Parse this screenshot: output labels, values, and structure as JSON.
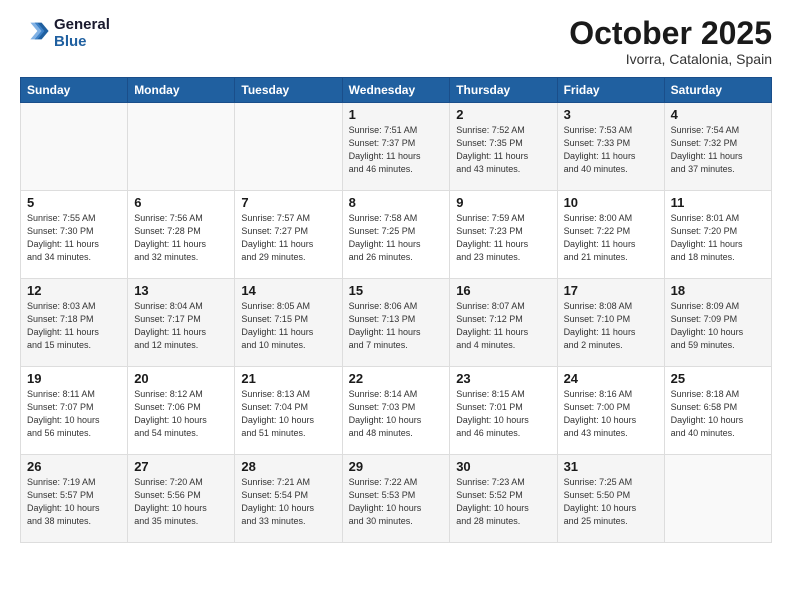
{
  "logo": {
    "line1": "General",
    "line2": "Blue"
  },
  "title": "October 2025",
  "subtitle": "Ivorra, Catalonia, Spain",
  "days_header": [
    "Sunday",
    "Monday",
    "Tuesday",
    "Wednesday",
    "Thursday",
    "Friday",
    "Saturday"
  ],
  "weeks": [
    [
      {
        "num": "",
        "info": ""
      },
      {
        "num": "",
        "info": ""
      },
      {
        "num": "",
        "info": ""
      },
      {
        "num": "1",
        "info": "Sunrise: 7:51 AM\nSunset: 7:37 PM\nDaylight: 11 hours\nand 46 minutes."
      },
      {
        "num": "2",
        "info": "Sunrise: 7:52 AM\nSunset: 7:35 PM\nDaylight: 11 hours\nand 43 minutes."
      },
      {
        "num": "3",
        "info": "Sunrise: 7:53 AM\nSunset: 7:33 PM\nDaylight: 11 hours\nand 40 minutes."
      },
      {
        "num": "4",
        "info": "Sunrise: 7:54 AM\nSunset: 7:32 PM\nDaylight: 11 hours\nand 37 minutes."
      }
    ],
    [
      {
        "num": "5",
        "info": "Sunrise: 7:55 AM\nSunset: 7:30 PM\nDaylight: 11 hours\nand 34 minutes."
      },
      {
        "num": "6",
        "info": "Sunrise: 7:56 AM\nSunset: 7:28 PM\nDaylight: 11 hours\nand 32 minutes."
      },
      {
        "num": "7",
        "info": "Sunrise: 7:57 AM\nSunset: 7:27 PM\nDaylight: 11 hours\nand 29 minutes."
      },
      {
        "num": "8",
        "info": "Sunrise: 7:58 AM\nSunset: 7:25 PM\nDaylight: 11 hours\nand 26 minutes."
      },
      {
        "num": "9",
        "info": "Sunrise: 7:59 AM\nSunset: 7:23 PM\nDaylight: 11 hours\nand 23 minutes."
      },
      {
        "num": "10",
        "info": "Sunrise: 8:00 AM\nSunset: 7:22 PM\nDaylight: 11 hours\nand 21 minutes."
      },
      {
        "num": "11",
        "info": "Sunrise: 8:01 AM\nSunset: 7:20 PM\nDaylight: 11 hours\nand 18 minutes."
      }
    ],
    [
      {
        "num": "12",
        "info": "Sunrise: 8:03 AM\nSunset: 7:18 PM\nDaylight: 11 hours\nand 15 minutes."
      },
      {
        "num": "13",
        "info": "Sunrise: 8:04 AM\nSunset: 7:17 PM\nDaylight: 11 hours\nand 12 minutes."
      },
      {
        "num": "14",
        "info": "Sunrise: 8:05 AM\nSunset: 7:15 PM\nDaylight: 11 hours\nand 10 minutes."
      },
      {
        "num": "15",
        "info": "Sunrise: 8:06 AM\nSunset: 7:13 PM\nDaylight: 11 hours\nand 7 minutes."
      },
      {
        "num": "16",
        "info": "Sunrise: 8:07 AM\nSunset: 7:12 PM\nDaylight: 11 hours\nand 4 minutes."
      },
      {
        "num": "17",
        "info": "Sunrise: 8:08 AM\nSunset: 7:10 PM\nDaylight: 11 hours\nand 2 minutes."
      },
      {
        "num": "18",
        "info": "Sunrise: 8:09 AM\nSunset: 7:09 PM\nDaylight: 10 hours\nand 59 minutes."
      }
    ],
    [
      {
        "num": "19",
        "info": "Sunrise: 8:11 AM\nSunset: 7:07 PM\nDaylight: 10 hours\nand 56 minutes."
      },
      {
        "num": "20",
        "info": "Sunrise: 8:12 AM\nSunset: 7:06 PM\nDaylight: 10 hours\nand 54 minutes."
      },
      {
        "num": "21",
        "info": "Sunrise: 8:13 AM\nSunset: 7:04 PM\nDaylight: 10 hours\nand 51 minutes."
      },
      {
        "num": "22",
        "info": "Sunrise: 8:14 AM\nSunset: 7:03 PM\nDaylight: 10 hours\nand 48 minutes."
      },
      {
        "num": "23",
        "info": "Sunrise: 8:15 AM\nSunset: 7:01 PM\nDaylight: 10 hours\nand 46 minutes."
      },
      {
        "num": "24",
        "info": "Sunrise: 8:16 AM\nSunset: 7:00 PM\nDaylight: 10 hours\nand 43 minutes."
      },
      {
        "num": "25",
        "info": "Sunrise: 8:18 AM\nSunset: 6:58 PM\nDaylight: 10 hours\nand 40 minutes."
      }
    ],
    [
      {
        "num": "26",
        "info": "Sunrise: 7:19 AM\nSunset: 5:57 PM\nDaylight: 10 hours\nand 38 minutes."
      },
      {
        "num": "27",
        "info": "Sunrise: 7:20 AM\nSunset: 5:56 PM\nDaylight: 10 hours\nand 35 minutes."
      },
      {
        "num": "28",
        "info": "Sunrise: 7:21 AM\nSunset: 5:54 PM\nDaylight: 10 hours\nand 33 minutes."
      },
      {
        "num": "29",
        "info": "Sunrise: 7:22 AM\nSunset: 5:53 PM\nDaylight: 10 hours\nand 30 minutes."
      },
      {
        "num": "30",
        "info": "Sunrise: 7:23 AM\nSunset: 5:52 PM\nDaylight: 10 hours\nand 28 minutes."
      },
      {
        "num": "31",
        "info": "Sunrise: 7:25 AM\nSunset: 5:50 PM\nDaylight: 10 hours\nand 25 minutes."
      },
      {
        "num": "",
        "info": ""
      }
    ]
  ]
}
